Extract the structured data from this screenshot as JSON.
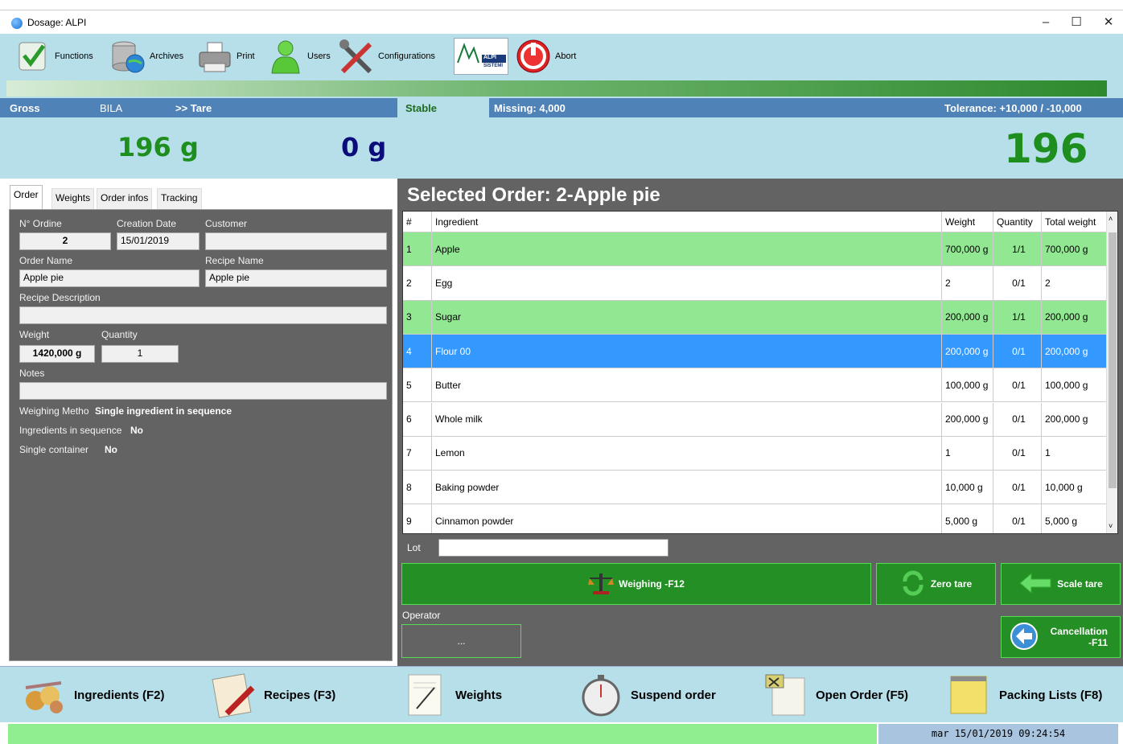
{
  "window": {
    "title": "Dosage: ALPI"
  },
  "toolbar": {
    "functions": "Functions",
    "archives": "Archives",
    "print": "Print",
    "users": "Users",
    "configurations": "Configurations",
    "abort": "Abort",
    "logo_text": "ALPI",
    "logo_sub": "SISTEMI"
  },
  "progress": {
    "fraction": 1.0
  },
  "scale": {
    "gross_label": "Gross",
    "scale_name": "BILA",
    "tare_label": ">>  Tare",
    "stable": "Stable",
    "missing": "Missing: 4,000",
    "tolerance": "Tolerance: +10,000 / -10,000",
    "gross_value": "196 g",
    "tare_value": "0 g",
    "net_value": "196 g",
    "colors": {
      "gross": "#1e8f1e",
      "tare": "#0b0b7a",
      "net": "#1e8f1e"
    }
  },
  "tabs": [
    "Order",
    "Weights",
    "Order infos",
    "Tracking"
  ],
  "order_form": {
    "ordine_label": "N° Ordine",
    "ordine_value": "2",
    "creation_label": "Creation Date",
    "creation_value": "15/01/2019",
    "customer_label": "Customer",
    "customer_value": "",
    "order_name_label": "Order Name",
    "order_name_value": "Apple pie",
    "recipe_name_label": "Recipe Name",
    "recipe_name_value": "Apple pie",
    "recipe_desc_label": "Recipe Description",
    "recipe_desc_value": "",
    "weight_label": "Weight",
    "weight_value": "1420,000 g",
    "quantity_label": "Quantity",
    "quantity_value": "1",
    "notes_label": "Notes",
    "notes_value": "",
    "method_label": "Weighing Metho",
    "method_value": "Single ingredient in sequence",
    "sequence_label": "Ingredients in sequence",
    "sequence_value": "No",
    "container_label": "Single container",
    "container_value": "No"
  },
  "order_panel": {
    "title": "Selected Order: 2-Apple pie",
    "columns": [
      "#",
      "Ingredient",
      "Weight",
      "Quantity",
      "Total weight"
    ],
    "rows": [
      {
        "n": "1",
        "ingredient": "Apple",
        "weight": "700,000 g",
        "qty": "1/1",
        "total": "700,000 g",
        "state": "done"
      },
      {
        "n": "2",
        "ingredient": "Egg",
        "weight": "2",
        "qty": "0/1",
        "total": "2",
        "state": ""
      },
      {
        "n": "3",
        "ingredient": "Sugar",
        "weight": "200,000 g",
        "qty": "1/1",
        "total": "200,000 g",
        "state": "done"
      },
      {
        "n": "4",
        "ingredient": "Flour 00",
        "weight": "200,000 g",
        "qty": "0/1",
        "total": "200,000 g",
        "state": "sel"
      },
      {
        "n": "5",
        "ingredient": "Butter",
        "weight": "100,000 g",
        "qty": "0/1",
        "total": "100,000 g",
        "state": ""
      },
      {
        "n": "6",
        "ingredient": "Whole milk",
        "weight": "200,000 g",
        "qty": "0/1",
        "total": "200,000 g",
        "state": ""
      },
      {
        "n": "7",
        "ingredient": "Lemon",
        "weight": "1",
        "qty": "0/1",
        "total": "1",
        "state": ""
      },
      {
        "n": "8",
        "ingredient": "Baking powder",
        "weight": "10,000 g",
        "qty": "0/1",
        "total": "10,000 g",
        "state": ""
      },
      {
        "n": "9",
        "ingredient": "Cinnamon powder",
        "weight": "5,000 g",
        "qty": "0/1",
        "total": "5,000 g",
        "state": ""
      }
    ],
    "lot_label": "Lot",
    "lot_value": "",
    "weighing_btn": "Weighing -F12",
    "zero_tare_btn": "Zero tare",
    "scale_tare_btn": "Scale tare",
    "operator_label": "Operator",
    "operator_btn": "...",
    "cancellation_btn_1": "Cancellation",
    "cancellation_btn_2": "-F11"
  },
  "bottom": {
    "ingredients": "Ingredients (F2)",
    "recipes": "Recipes (F3)",
    "weights": "Weights",
    "suspend": "Suspend order",
    "open_order": "Open Order (F5)",
    "packing": "Packing Lists (F8)"
  },
  "statusbar": {
    "datetime": "mar 15/01/2019 09:24:54"
  }
}
